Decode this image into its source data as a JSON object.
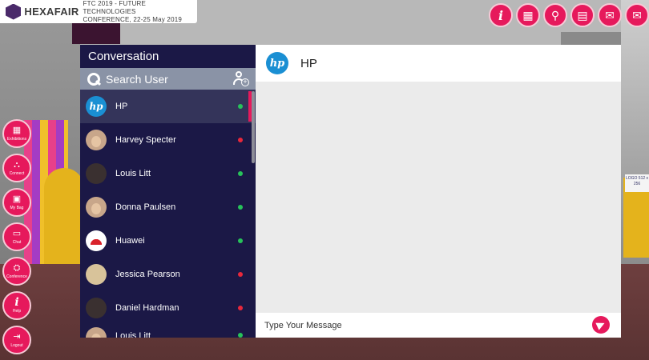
{
  "header": {
    "brand": "HEXAFAIR",
    "event_line1": "FTC 2019 - FUTURE TECHNOLOGIES",
    "event_line2": "CONFERENCE, 22-25 May 2019"
  },
  "top_icons": [
    {
      "name": "info-icon",
      "glyph": "i"
    },
    {
      "name": "booth-icon",
      "glyph": "▦"
    },
    {
      "name": "search-booth-icon",
      "glyph": "⚲"
    },
    {
      "name": "business-card-icon",
      "glyph": "▤"
    },
    {
      "name": "chat-icon",
      "glyph": "✉"
    },
    {
      "name": "mail-icon",
      "glyph": "✉"
    }
  ],
  "side_nav": [
    {
      "label": "Exhibitions",
      "glyph": "▦"
    },
    {
      "label": "Connect",
      "glyph": "⛬"
    },
    {
      "label": "My Bag",
      "glyph": "▣"
    },
    {
      "label": "Chat",
      "glyph": "▭"
    },
    {
      "label": "Conference",
      "glyph": "⛭"
    },
    {
      "label": "Help",
      "glyph": "i"
    },
    {
      "label": "Logout",
      "glyph": "⇥"
    }
  ],
  "conversation": {
    "title": "Conversation",
    "search_placeholder": "Search User",
    "contacts": [
      {
        "name": "HP",
        "status": "online",
        "avatar": "hp"
      },
      {
        "name": "Harvey Specter",
        "status": "offline",
        "avatar": "person"
      },
      {
        "name": "Louis Litt",
        "status": "online",
        "avatar": "dark"
      },
      {
        "name": "Donna Paulsen",
        "status": "online",
        "avatar": "person"
      },
      {
        "name": "Huawei",
        "status": "online",
        "avatar": "huawei"
      },
      {
        "name": "Jessica Pearson",
        "status": "offline",
        "avatar": "blond"
      },
      {
        "name": "Daniel Hardman",
        "status": "offline",
        "avatar": "dark"
      },
      {
        "name": "Louis Litt",
        "status": "online",
        "avatar": "person"
      }
    ]
  },
  "thread": {
    "title": "HP",
    "avatar_text": "hp",
    "message_placeholder": "Type Your Message"
  },
  "colors": {
    "accent": "#e6195c",
    "online": "#27c25a",
    "offline": "#e8283b",
    "panel": "#1b1846"
  },
  "background": {
    "logo_sign": "LOGO 512 x 256"
  }
}
